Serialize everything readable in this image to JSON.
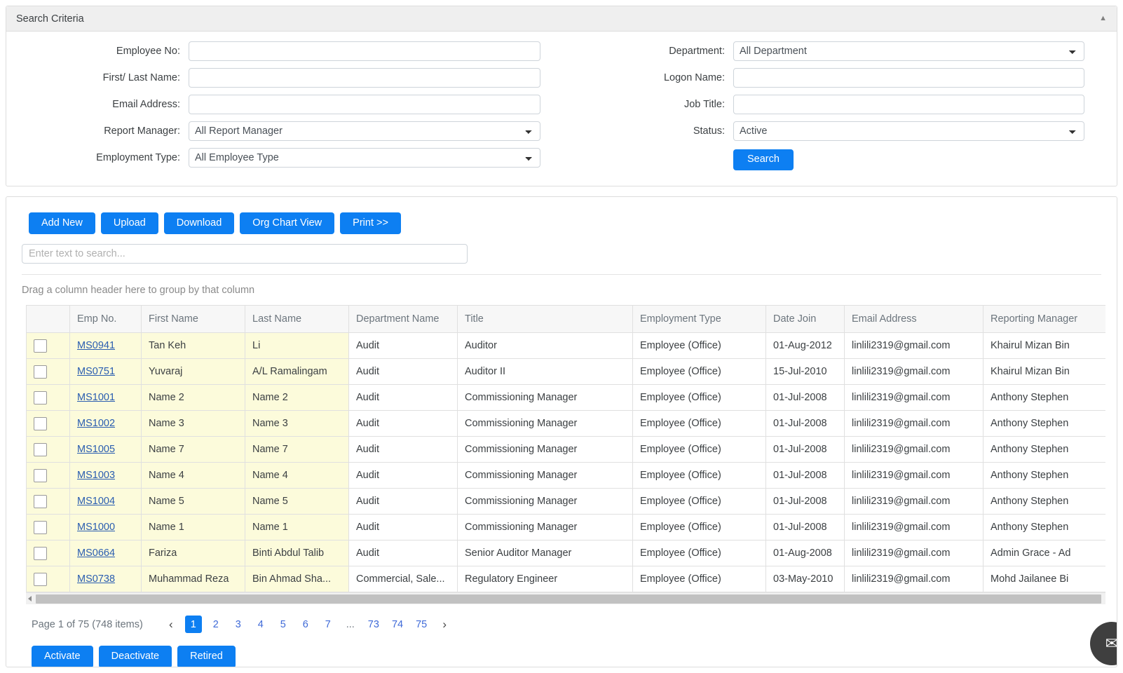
{
  "search_panel": {
    "title": "Search Criteria",
    "collapse_icon": "chevron-up-icon",
    "left_fields": [
      {
        "label": "Employee No:",
        "type": "text",
        "value": "",
        "placeholder": ""
      },
      {
        "label": "First/ Last Name:",
        "type": "text",
        "value": "",
        "placeholder": ""
      },
      {
        "label": "Email Address:",
        "type": "text",
        "value": "",
        "placeholder": ""
      },
      {
        "label": "Report Manager:",
        "type": "select",
        "value": "All Report Manager"
      },
      {
        "label": "Employment Type:",
        "type": "select",
        "value": "All Employee Type"
      }
    ],
    "right_fields": [
      {
        "label": "Department:",
        "type": "select",
        "value": "All Department"
      },
      {
        "label": "Logon Name:",
        "type": "text",
        "value": "",
        "placeholder": ""
      },
      {
        "label": "Job Title:",
        "type": "text",
        "value": "",
        "placeholder": ""
      },
      {
        "label": "Status:",
        "type": "select",
        "value": "Active"
      }
    ],
    "search_button": "Search"
  },
  "toolbar": {
    "buttons": [
      "Add New",
      "Upload",
      "Download",
      "Org Chart View",
      "Print >>"
    ]
  },
  "grid_search": {
    "placeholder": "Enter text to search...",
    "value": ""
  },
  "group_hint": "Drag a column header here to group by that column",
  "grid": {
    "columns": [
      "",
      "Emp No.",
      "First Name",
      "Last Name",
      "Department Name",
      "Title",
      "Employment Type",
      "Date Join",
      "Email Address",
      "Reporting Manager"
    ],
    "rows": [
      {
        "emp_no": "MS0941",
        "first_name": "Tan Keh",
        "last_name": "Li",
        "department": "Audit",
        "title": "Auditor",
        "employment_type": "Employee (Office)",
        "date_join": "01-Aug-2012",
        "email": "linlili2319@gmail.com",
        "reporting_manager": "Khairul Mizan Bin"
      },
      {
        "emp_no": "MS0751",
        "first_name": "Yuvaraj",
        "last_name": "A/L Ramalingam",
        "department": "Audit",
        "title": "Auditor II",
        "employment_type": "Employee (Office)",
        "date_join": "15-Jul-2010",
        "email": "linlili2319@gmail.com",
        "reporting_manager": "Khairul Mizan Bin"
      },
      {
        "emp_no": "MS1001",
        "first_name": "Name 2",
        "last_name": "Name 2",
        "department": "Audit",
        "title": "Commissioning Manager",
        "employment_type": "Employee (Office)",
        "date_join": "01-Jul-2008",
        "email": "linlili2319@gmail.com",
        "reporting_manager": "Anthony Stephen"
      },
      {
        "emp_no": "MS1002",
        "first_name": "Name 3",
        "last_name": "Name 3",
        "department": "Audit",
        "title": "Commissioning Manager",
        "employment_type": "Employee (Office)",
        "date_join": "01-Jul-2008",
        "email": "linlili2319@gmail.com",
        "reporting_manager": "Anthony Stephen"
      },
      {
        "emp_no": "MS1005",
        "first_name": "Name 7",
        "last_name": "Name 7",
        "department": "Audit",
        "title": "Commissioning Manager",
        "employment_type": "Employee (Office)",
        "date_join": "01-Jul-2008",
        "email": "linlili2319@gmail.com",
        "reporting_manager": "Anthony Stephen"
      },
      {
        "emp_no": "MS1003",
        "first_name": "Name 4",
        "last_name": "Name 4",
        "department": "Audit",
        "title": "Commissioning Manager",
        "employment_type": "Employee (Office)",
        "date_join": "01-Jul-2008",
        "email": "linlili2319@gmail.com",
        "reporting_manager": "Anthony Stephen"
      },
      {
        "emp_no": "MS1004",
        "first_name": "Name 5",
        "last_name": "Name 5",
        "department": "Audit",
        "title": "Commissioning Manager",
        "employment_type": "Employee (Office)",
        "date_join": "01-Jul-2008",
        "email": "linlili2319@gmail.com",
        "reporting_manager": "Anthony Stephen"
      },
      {
        "emp_no": "MS1000",
        "first_name": "Name 1",
        "last_name": "Name 1",
        "department": "Audit",
        "title": "Commissioning Manager",
        "employment_type": "Employee (Office)",
        "date_join": "01-Jul-2008",
        "email": "linlili2319@gmail.com",
        "reporting_manager": "Anthony Stephen"
      },
      {
        "emp_no": "MS0664",
        "first_name": "Fariza",
        "last_name": "Binti Abdul Talib",
        "department": "Audit",
        "title": "Senior Auditor Manager",
        "employment_type": "Employee (Office)",
        "date_join": "01-Aug-2008",
        "email": "linlili2319@gmail.com",
        "reporting_manager": "Admin Grace - Ad"
      },
      {
        "emp_no": "MS0738",
        "first_name": "Muhammad Reza",
        "last_name": "Bin Ahmad Sha...",
        "department": "Commercial, Sale...",
        "title": "Regulatory Engineer",
        "employment_type": "Employee (Office)",
        "date_join": "03-May-2010",
        "email": "linlili2319@gmail.com",
        "reporting_manager": "Mohd Jailanee Bi"
      }
    ]
  },
  "pager": {
    "info": "Page 1 of 75 (748 items)",
    "prev_icon": "chevron-left-icon",
    "next_icon": "chevron-right-icon",
    "pages": [
      "1",
      "2",
      "3",
      "4",
      "5",
      "6",
      "7",
      "...",
      "73",
      "74",
      "75"
    ],
    "active_page": "1"
  },
  "bottom_buttons": [
    "Activate",
    "Deactivate",
    "Retired"
  ],
  "fab": {
    "icon": "chat-icon",
    "label": "✉"
  },
  "colors": {
    "primary": "#0d7ff2",
    "row_highlight": "#fcfbdb",
    "header_bg": "#f7f7f7",
    "panel_head_bg": "#efefef",
    "link": "#2a5db0"
  }
}
